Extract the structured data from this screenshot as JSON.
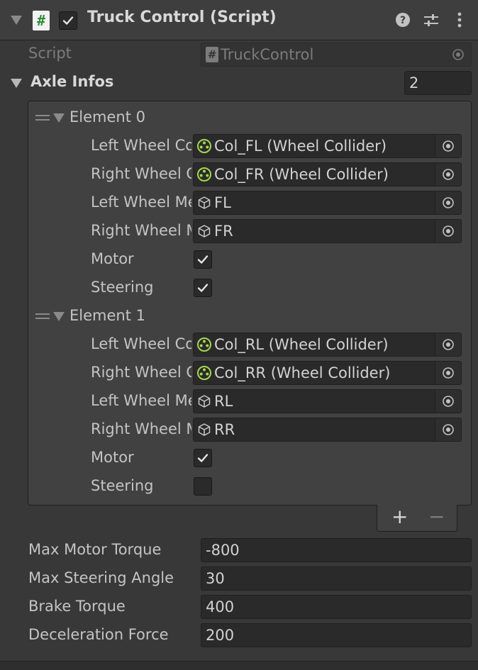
{
  "component": {
    "title": "Truck Control (Script)",
    "enabled": true,
    "icons": [
      "help-icon",
      "preset-icon",
      "more-menu-icon"
    ]
  },
  "script": {
    "label": "Script",
    "value": "TruckControl"
  },
  "axle_infos": {
    "label": "Axle Infos",
    "size": "2",
    "elements": [
      {
        "label": "Element 0",
        "left_wheel_collider_label": "Left Wheel Collider",
        "left_wheel_collider": "Col_FL (Wheel Collider)",
        "right_wheel_collider_label": "Right Wheel Collider",
        "right_wheel_collider": "Col_FR (Wheel Collider)",
        "left_wheel_mesh_label": "Left Wheel Mesh",
        "left_wheel_mesh": "FL",
        "right_wheel_mesh_label": "Right Wheel Mesh",
        "right_wheel_mesh": "FR",
        "motor_label": "Motor",
        "motor": true,
        "steering_label": "Steering",
        "steering": true
      },
      {
        "label": "Element 1",
        "left_wheel_collider_label": "Left Wheel Collider",
        "left_wheel_collider": "Col_RL (Wheel Collider)",
        "right_wheel_collider_label": "Right Wheel Collider",
        "right_wheel_collider": "Col_RR (Wheel Collider)",
        "left_wheel_mesh_label": "Left Wheel Mesh",
        "left_wheel_mesh": "RL",
        "right_wheel_mesh_label": "Right Wheel Mesh",
        "right_wheel_mesh": "RR",
        "motor_label": "Motor",
        "motor": true,
        "steering_label": "Steering",
        "steering": false
      }
    ],
    "add_label": "+",
    "remove_label": "−"
  },
  "fields": {
    "max_motor_torque": {
      "label": "Max Motor Torque",
      "value": "-800"
    },
    "max_steering_angle": {
      "label": "Max Steering Angle",
      "value": "30"
    },
    "brake_torque": {
      "label": "Brake Torque",
      "value": "400"
    },
    "deceleration_force": {
      "label": "Deceleration Force",
      "value": "200"
    }
  },
  "colors": {
    "background": "#383838",
    "field": "#2a2a2a",
    "collider_icon": "#a6d84a"
  }
}
